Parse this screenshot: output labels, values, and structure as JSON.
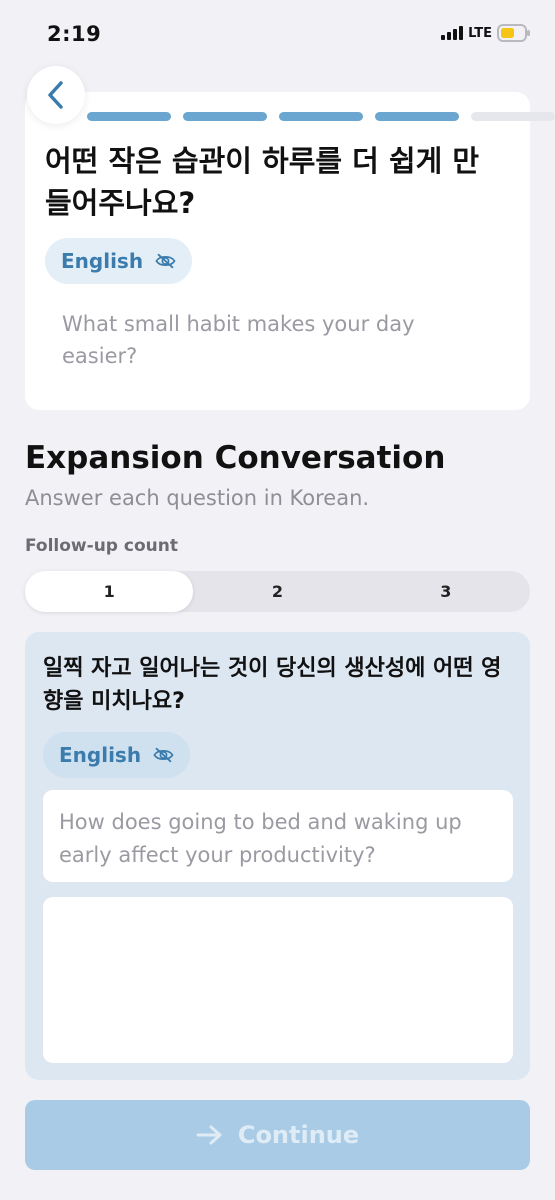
{
  "status_bar": {
    "time": "2:19",
    "network": "LTE"
  },
  "progress": {
    "total_steps": 5,
    "completed_steps": 4
  },
  "question": {
    "korean": "어떤 작은 습관이 하루를 더 쉽게 만들어주나요?",
    "english": "What small habit makes your day easier?"
  },
  "translation_toggle_label": "English",
  "section": {
    "title": "Expansion Conversation",
    "subtitle": "Answer each question in Korean."
  },
  "followup": {
    "count_label": "Follow-up count",
    "options": [
      "1",
      "2",
      "3"
    ],
    "selected": "1",
    "question_korean": "일찍 자고 일어나는 것이 당신의 생산성에 어떤 영향을 미치나요?",
    "question_english": "How does going to bed and waking up early affect your productivity?",
    "answer_value": ""
  },
  "continue_label": "Continue",
  "colors": {
    "accent": "#3b7cad",
    "progress_filled": "#6aa6cf",
    "card_tint": "#dde7f2",
    "button_disabled": "#a9cbe6"
  },
  "icons": {
    "back": "chevron-left-icon",
    "toggle": "eye-slash-icon",
    "continue": "arrow-right-icon"
  }
}
